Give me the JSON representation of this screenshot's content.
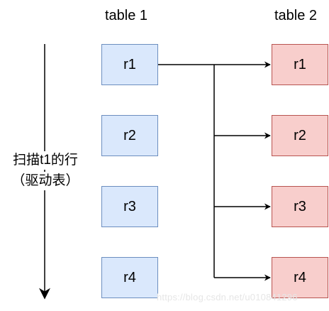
{
  "tables": [
    {
      "title": "table 1",
      "rows": [
        "r1",
        "r2",
        "r3",
        "r4"
      ]
    },
    {
      "title": "table 2",
      "rows": [
        "r1",
        "r2",
        "r3",
        "r4"
      ]
    }
  ],
  "scan_label": {
    "line1": "扫描t1的行",
    "line2": "（驱动表）"
  },
  "watermark": "https://blog.csdn.net/u010841296",
  "colors": {
    "table1_fill": "#dae8fc",
    "table1_stroke": "#6c8ebf",
    "table2_fill": "#f8cecc",
    "table2_stroke": "#b85450",
    "line": "#000000"
  }
}
